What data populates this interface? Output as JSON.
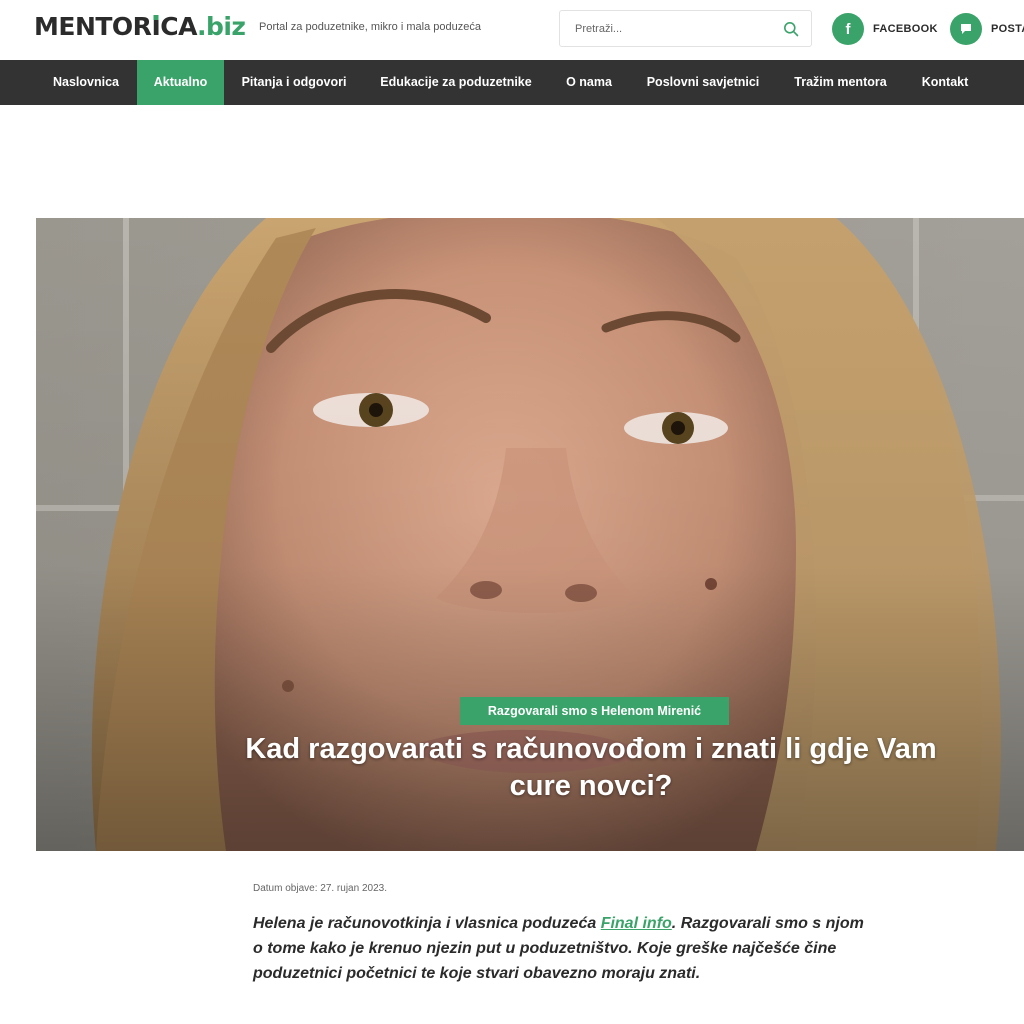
{
  "site": {
    "logo_main": "MENTOR",
    "logo_i": "I",
    "logo_rest": "CA",
    "logo_tld": ".biz",
    "tagline": "Portal za poduzetnike, mikro i mala poduzeća"
  },
  "search": {
    "placeholder": "Pretraži..."
  },
  "social": {
    "facebook_label": "FACEBOOK",
    "facebook_glyph": "f",
    "post_label": "POSTA"
  },
  "nav": {
    "items": [
      "Naslovnica",
      "Aktualno",
      "Pitanja i odgovori",
      "Edukacije za poduzetnike",
      "O nama",
      "Poslovni savjetnici",
      "Tražim mentora",
      "Kontakt"
    ],
    "active_index": 1
  },
  "article": {
    "badge": "Razgovarali smo s Helenom Mirenić",
    "title": "Kad razgovarati s računovođom i znati li gdje Vam cure novci?",
    "date": "Datum objave: 27. rujan 2023.",
    "intro_before_link": "Helena je računovotkinja i vlasnica poduzeća ",
    "intro_link": "Final info",
    "intro_after_link": ". Razgovarali smo s njom o tome kako je krenuo njezin put u poduzetništvo. Koje greške najčešće čine poduzetnici početnici te koje stvari obavezno moraju znati."
  },
  "colors": {
    "accent": "#3aa36a",
    "nav_bg": "#333333",
    "text": "#2b2b2b"
  }
}
